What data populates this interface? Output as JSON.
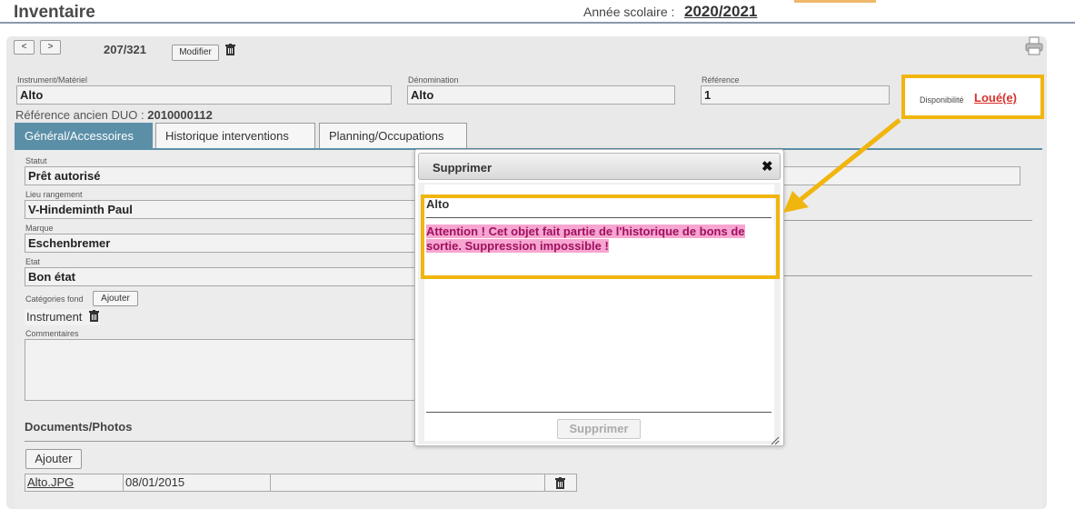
{
  "header": {
    "title": "Inventaire",
    "year_label": "Année scolaire :",
    "year_value": "2020/2021"
  },
  "nav": {
    "prev_label": "<",
    "next_label": ">",
    "counter": "207/321",
    "modify_label": "Modifier"
  },
  "record": {
    "instrument_label": "Instrument/Matériel",
    "instrument_value": "Alto",
    "denomination_label": "Dénomination",
    "denomination_value": "Alto",
    "reference_label": "Référence",
    "reference_value": "1",
    "availability_label": "Disponibilité",
    "availability_value": "Loué(e)",
    "old_ref_label": "Référence ancien DUO :",
    "old_ref_value": "2010000112"
  },
  "tabs": [
    "Général/Accessoires",
    "Historique interventions",
    "Planning/Occupations"
  ],
  "general": {
    "status_label": "Statut",
    "status_value": "Prêt autorisé",
    "location_label": "Lieu rangement",
    "location_value": "V-Hindeminth Paul",
    "brand_label": "Marque",
    "brand_value": "Eschenbremer",
    "state_label": "Etat",
    "state_value": "Bon état",
    "categories_label": "Catégories fond",
    "categories_add": "Ajouter",
    "category_tag": "Instrument",
    "comments_label": "Commentaires"
  },
  "documents": {
    "title": "Documents/Photos",
    "add_label": "Ajouter",
    "files": [
      {
        "name": "Alto.JPG",
        "date": "08/01/2015"
      }
    ]
  },
  "modal": {
    "title": "Supprimer",
    "close": "✖",
    "item": "Alto",
    "warning": "Attention ! Cet objet fait partie de l'historique de bons de sortie. Suppression impossible !",
    "button": "Supprimer"
  },
  "colors": {
    "accent_highlight": "#f1b50f",
    "tab_active": "#5b8fa8",
    "warning_bg": "#f6a6d0",
    "availability": "#d9312e"
  }
}
